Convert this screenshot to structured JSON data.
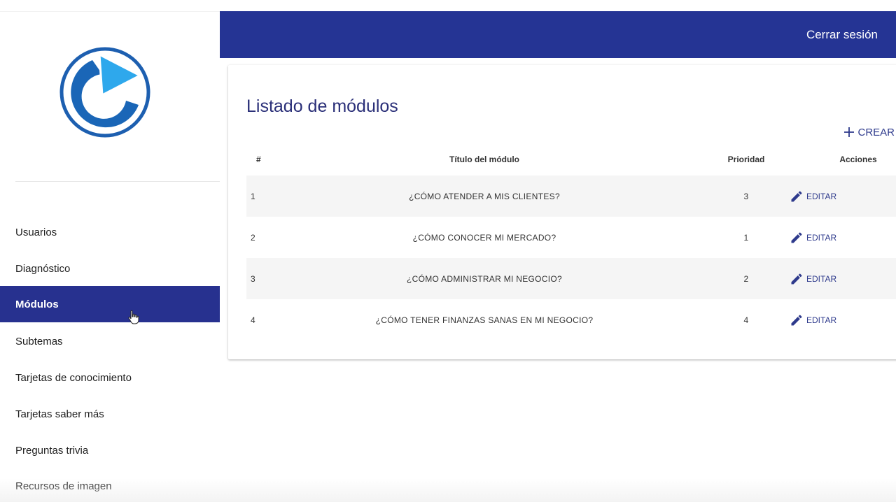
{
  "header": {
    "logout_label": "Cerrar sesión",
    "color": "#253494"
  },
  "sidebar": {
    "logo_icon": "play-circle-logo-icon",
    "items": [
      {
        "label": "Usuarios",
        "active": false
      },
      {
        "label": "Diagnóstico",
        "active": false
      },
      {
        "label": "Módulos",
        "active": true
      },
      {
        "label": "Subtemas",
        "active": false
      },
      {
        "label": "Tarjetas de conocimiento",
        "active": false
      },
      {
        "label": "Tarjetas saber más",
        "active": false
      },
      {
        "label": "Preguntas trivia",
        "active": false
      },
      {
        "label": "Recursos de imagen",
        "active": false
      }
    ],
    "active_color": "#27318f"
  },
  "main": {
    "title": "Listado de módulos",
    "create_label": "CREAR",
    "table": {
      "headers": [
        "#",
        "Título del módulo",
        "Prioridad",
        "Acciones"
      ],
      "edit_label": "EDITAR",
      "rows": [
        {
          "num": "1",
          "title": "¿CÓMO ATENDER A MIS CLIENTES?",
          "priority": "3"
        },
        {
          "num": "2",
          "title": "¿CÓMO CONOCER MI MERCADO?",
          "priority": "1"
        },
        {
          "num": "3",
          "title": "¿CÓMO ADMINISTRAR MI NEGOCIO?",
          "priority": "2"
        },
        {
          "num": "4",
          "title": "¿CÓMO TENER FINANZAS SANAS EN MI NEGOCIO?",
          "priority": "4"
        }
      ]
    }
  }
}
